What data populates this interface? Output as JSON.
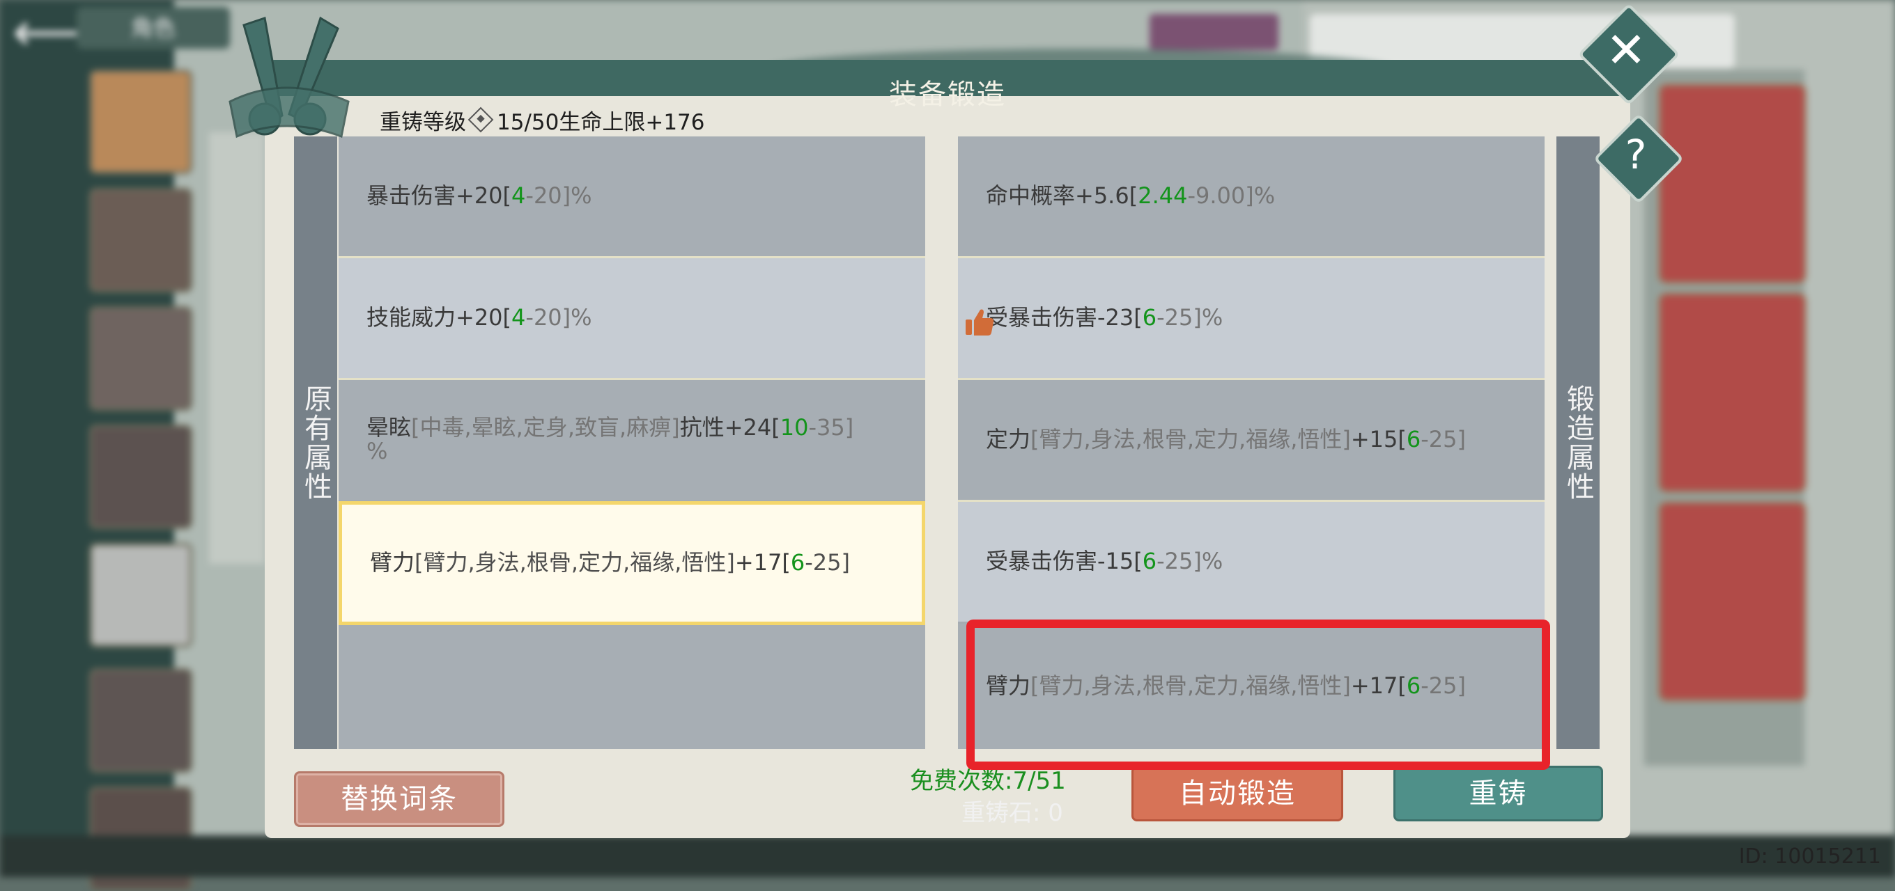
{
  "background": {
    "back_label": "",
    "top_tab_label": "角色"
  },
  "dialog": {
    "title": "装备锻造",
    "recast_level_label": "重铸等级",
    "recast_level_value": "15/50",
    "recast_bonus": "生命上限+176",
    "left_strip_label": "原有属性",
    "right_strip_label": "锻造属性",
    "original_attributes": [
      {
        "name": "暴击伤害+20[",
        "min": "4",
        "sep": "-20]%",
        "tail": ""
      },
      {
        "name": "技能威力+20[",
        "min": "4",
        "sep": "-20]%",
        "tail": ""
      },
      {
        "name": "晕眩",
        "range_text": "[中毒,晕眩,定身,致盲,麻痹]",
        "bonus": "抗性+24[",
        "min": "10",
        "sep": "-35]",
        "tail": "%"
      },
      {
        "name": "臂力",
        "range_text": "[臂力,身法,根骨,定力,福缘,悟性]",
        "bonus": "+17[",
        "min": "6",
        "sep": "-25]",
        "tail": ""
      }
    ],
    "forged_attributes": [
      {
        "name": "命中概率+5.6[",
        "min": "2.44",
        "sep": "-9.00]%"
      },
      {
        "name": "受暴击伤害-23[",
        "min": "6",
        "sep": "-25]%"
      },
      {
        "name": "定力",
        "range_text": "[臂力,身法,根骨,定力,福缘,悟性]",
        "bonus": "+15[",
        "min": "6",
        "sep": "-25]"
      },
      {
        "name": "受暴击伤害-15[",
        "min": "6",
        "sep": "-25]%"
      },
      {
        "name": "臂力",
        "range_text": "[臂力,身法,根骨,定力,福缘,悟性]",
        "bonus": "+17[",
        "min": "6",
        "sep": "-25]"
      }
    ],
    "free_count_label": "免费次数:7/51",
    "recast_stone_label": "重铸石: 0",
    "buttons": {
      "replace": "替换词条",
      "auto_forge": "自动锻造",
      "recast": "重铸"
    },
    "close_symbol": "✕",
    "help_symbol": "?"
  },
  "footer": {
    "user_id": "ID: 10015211"
  },
  "colors": {
    "accent_green": "#13941b",
    "highlight_red": "#e8232a",
    "header_teal": "#3f6962"
  },
  "icons": [
    "back-arrow-icon",
    "sword-emblem-icon",
    "thumbs-up-icon",
    "close-icon",
    "help-icon",
    "diamond-icon"
  ]
}
